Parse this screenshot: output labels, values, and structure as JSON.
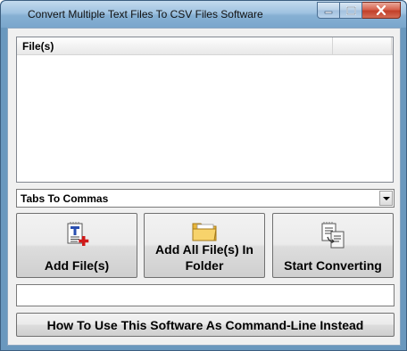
{
  "window": {
    "title": "Convert Multiple Text Files To CSV Files Software"
  },
  "icons": {
    "minimize": "minimize-icon",
    "maximize": "maximize-icon",
    "close": "close-icon",
    "add_files": "text-file-add-icon",
    "add_folder": "folder-icon",
    "start": "document-convert-icon",
    "combo_arrow": "chevron-down-icon"
  },
  "file_list": {
    "columns": [
      "File(s)",
      ""
    ],
    "rows": []
  },
  "conversion_mode": {
    "selected": "Tabs To Commas"
  },
  "buttons": {
    "add_files": "Add File(s)",
    "add_folder": "Add All File(s) In Folder",
    "start": "Start Converting",
    "command_line": "How To Use This Software As Command-Line Instead"
  },
  "status": {
    "text": ""
  },
  "colors": {
    "titlebar": "#9fc2e0",
    "close_button": "#c2402a",
    "client_bg": "#f0f0f0"
  }
}
